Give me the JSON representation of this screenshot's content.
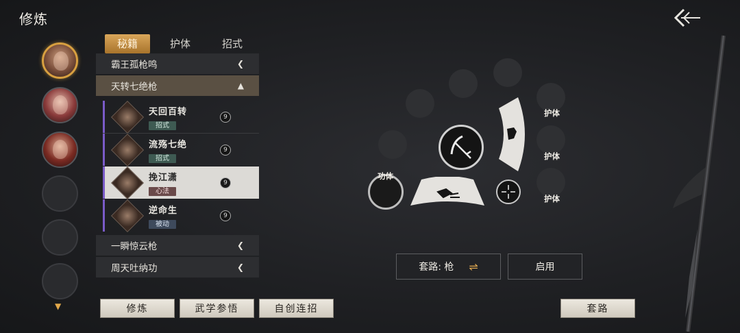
{
  "header": {
    "title": "修炼"
  },
  "tabs": [
    {
      "label": "秘籍",
      "active": true
    },
    {
      "label": "护体",
      "active": false
    },
    {
      "label": "招式",
      "active": false
    }
  ],
  "groups": {
    "g1": {
      "label": "霸王孤枪鸣",
      "open": false
    },
    "g2": {
      "label": "天转七绝枪",
      "open": true
    },
    "g3": {
      "label": "一瞬惊云枪",
      "open": false
    },
    "g4": {
      "label": "周天吐纳功",
      "open": false
    }
  },
  "skills": [
    {
      "name": "天回百转",
      "tag": "招式",
      "badge": "9"
    },
    {
      "name": "流殇七绝",
      "tag": "招式",
      "badge": "9"
    },
    {
      "name": "挽江潇",
      "tag": "心法",
      "badge": "9",
      "selected": true
    },
    {
      "name": "逆命生",
      "tag": "被动",
      "badge": "9"
    }
  ],
  "wheel": {
    "gongti_label": "功体",
    "huti_labels": [
      "护体",
      "护体",
      "护体"
    ]
  },
  "routine": {
    "label": "套路: 枪",
    "enable_label": "启用"
  },
  "bottom_buttons": {
    "cultivate": "修炼",
    "martial_study": "武学参悟",
    "custom_combo": "自创连招",
    "routine": "套路"
  },
  "colors": {
    "accent_gold": "#d9a65a",
    "selected_bar": "#7a5bc8"
  }
}
